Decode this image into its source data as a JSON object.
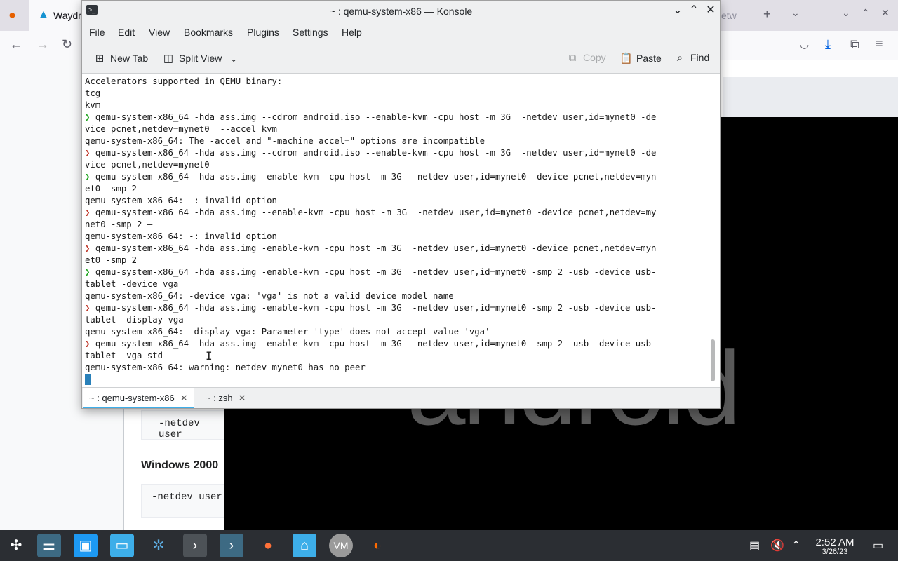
{
  "firefox": {
    "tab_active_title": "Waydr",
    "tab2_title": "etw",
    "heading_windows": "Windows 2000",
    "code1": "-netdev user",
    "code2": "-netdev user",
    "android_text": "android"
  },
  "konsole": {
    "window_title": "~ : qemu-system-x86 — Konsole",
    "menu": [
      "File",
      "Edit",
      "View",
      "Bookmarks",
      "Plugins",
      "Settings",
      "Help"
    ],
    "toolbar": {
      "new_tab": "New Tab",
      "split_view": "Split View",
      "copy": "Copy",
      "paste": "Paste",
      "find": "Find"
    },
    "lines": [
      {
        "p": "",
        "t": "Accelerators supported in QEMU binary:"
      },
      {
        "p": "",
        "t": "tcg"
      },
      {
        "p": "",
        "t": "kvm"
      },
      {
        "p": "❯ ",
        "t": "qemu-system-x86_64 -hda ass.img --cdrom android.iso --enable-kvm -cpu host -m 3G  -netdev user,id=mynet0 -de"
      },
      {
        "p": "",
        "t": "vice pcnet,netdev=mynet0  --accel kvm"
      },
      {
        "p": "",
        "t": "qemu-system-x86_64: The -accel and \"-machine accel=\" options are incompatible"
      },
      {
        "p": "❯ ",
        "t": "qemu-system-x86_64 -hda ass.img --cdrom android.iso --enable-kvm -cpu host -m 3G  -netdev user,id=mynet0 -de",
        "err": true
      },
      {
        "p": "",
        "t": "vice pcnet,netdev=mynet0"
      },
      {
        "p": "❯ ",
        "t": "qemu-system-x86_64 -hda ass.img -enable-kvm -cpu host -m 3G  -netdev user,id=mynet0 -device pcnet,netdev=myn"
      },
      {
        "p": "",
        "t": "et0 -smp 2 –"
      },
      {
        "p": "",
        "t": "qemu-system-x86_64: -: invalid option"
      },
      {
        "p": "❯ ",
        "t": "qemu-system-x86_64 -hda ass.img --enable-kvm -cpu host -m 3G  -netdev user,id=mynet0 -device pcnet,netdev=my",
        "err": true
      },
      {
        "p": "",
        "t": "net0 -smp 2 –"
      },
      {
        "p": "",
        "t": "qemu-system-x86_64: -: invalid option"
      },
      {
        "p": "❯ ",
        "t": "qemu-system-x86_64 -hda ass.img -enable-kvm -cpu host -m 3G  -netdev user,id=mynet0 -device pcnet,netdev=myn",
        "err": true
      },
      {
        "p": "",
        "t": "et0 -smp 2"
      },
      {
        "p": "❯ ",
        "t": "qemu-system-x86_64 -hda ass.img -enable-kvm -cpu host -m 3G  -netdev user,id=mynet0 -smp 2 -usb -device usb-"
      },
      {
        "p": "",
        "t": "tablet -device vga"
      },
      {
        "p": "",
        "t": "qemu-system-x86_64: -device vga: 'vga' is not a valid device model name"
      },
      {
        "p": "❯ ",
        "t": "qemu-system-x86_64 -hda ass.img -enable-kvm -cpu host -m 3G  -netdev user,id=mynet0 -smp 2 -usb -device usb-",
        "err": true
      },
      {
        "p": "",
        "t": "tablet -display vga"
      },
      {
        "p": "",
        "t": "qemu-system-x86_64: -display vga: Parameter 'type' does not accept value 'vga'"
      },
      {
        "p": "❯ ",
        "t": "qemu-system-x86_64 -hda ass.img -enable-kvm -cpu host -m 3G  -netdev user,id=mynet0 -smp 2 -usb -device usb-",
        "err": true
      },
      {
        "p": "",
        "t": "tablet -vga std"
      },
      {
        "p": "",
        "t": "qemu-system-x86_64: warning: netdev mynet0 has no peer"
      }
    ],
    "tabs": [
      {
        "label": "~ : qemu-system-x86"
      },
      {
        "label": "~ : zsh"
      }
    ]
  },
  "taskbar": {
    "time": "2:52 AM",
    "date": "3/26/23"
  },
  "colors": {
    "prompt_ok": "#1fa51f",
    "prompt_err": "#c0392b",
    "taskbar_bg": "#2b2e33",
    "tab_active_underline": "#3daee9"
  }
}
